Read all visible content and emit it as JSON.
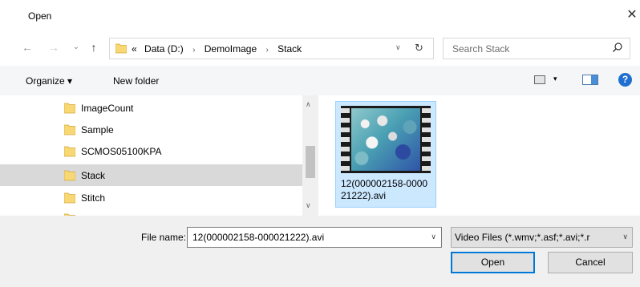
{
  "window": {
    "title": "Open",
    "close_glyph": "✕"
  },
  "nav": {
    "back": "←",
    "forward": "→",
    "recent": "⌄",
    "up": "↑"
  },
  "address": {
    "overflow": "«",
    "crumbs": [
      "Data (D:)",
      "DemoImage",
      "Stack"
    ],
    "separator": "›"
  },
  "search": {
    "placeholder": "Search Stack"
  },
  "toolbar": {
    "organize": "Organize ▾",
    "new_folder": "New folder",
    "view_menu": "▾",
    "help": "?"
  },
  "folders": [
    {
      "label": "ImageCount",
      "selected": false
    },
    {
      "label": "Sample",
      "selected": false
    },
    {
      "label": "SCMOS05100KPA",
      "selected": false
    },
    {
      "label": "Stack",
      "selected": true
    },
    {
      "label": "Stitch",
      "selected": false
    }
  ],
  "files": [
    {
      "name": "12(000002158-000021222).avi",
      "icon": "video-thumbnail",
      "selected": true
    }
  ],
  "footer": {
    "file_name_label": "File name:",
    "file_name_value": "12(000002158-000021222).avi",
    "file_type": "Video Files (*.wmv;*.asf;*.avi;*.r",
    "open_label": "Open",
    "cancel_label": "Cancel"
  },
  "colors": {
    "accent": "#0078d7",
    "selection": "#cce8ff",
    "folder": "#f8d775"
  }
}
